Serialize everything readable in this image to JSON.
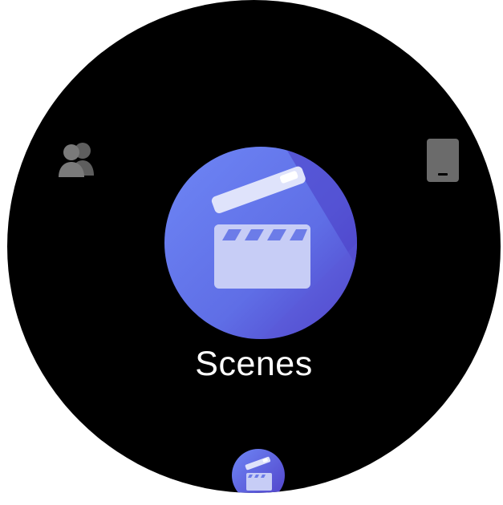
{
  "app": {
    "current_item": {
      "label": "Scenes",
      "icon": "clapperboard-icon"
    },
    "left_item": {
      "icon": "contacts-icon"
    },
    "right_item": {
      "icon": "tablet-device-icon"
    },
    "indicator": {
      "icon": "clapperboard-icon"
    }
  },
  "colors": {
    "background": "#000000",
    "accent_light": "#6a80f2",
    "accent_dark": "#5a3fd0",
    "icon_gray": "#6b6b6b",
    "label": "#ffffff"
  }
}
